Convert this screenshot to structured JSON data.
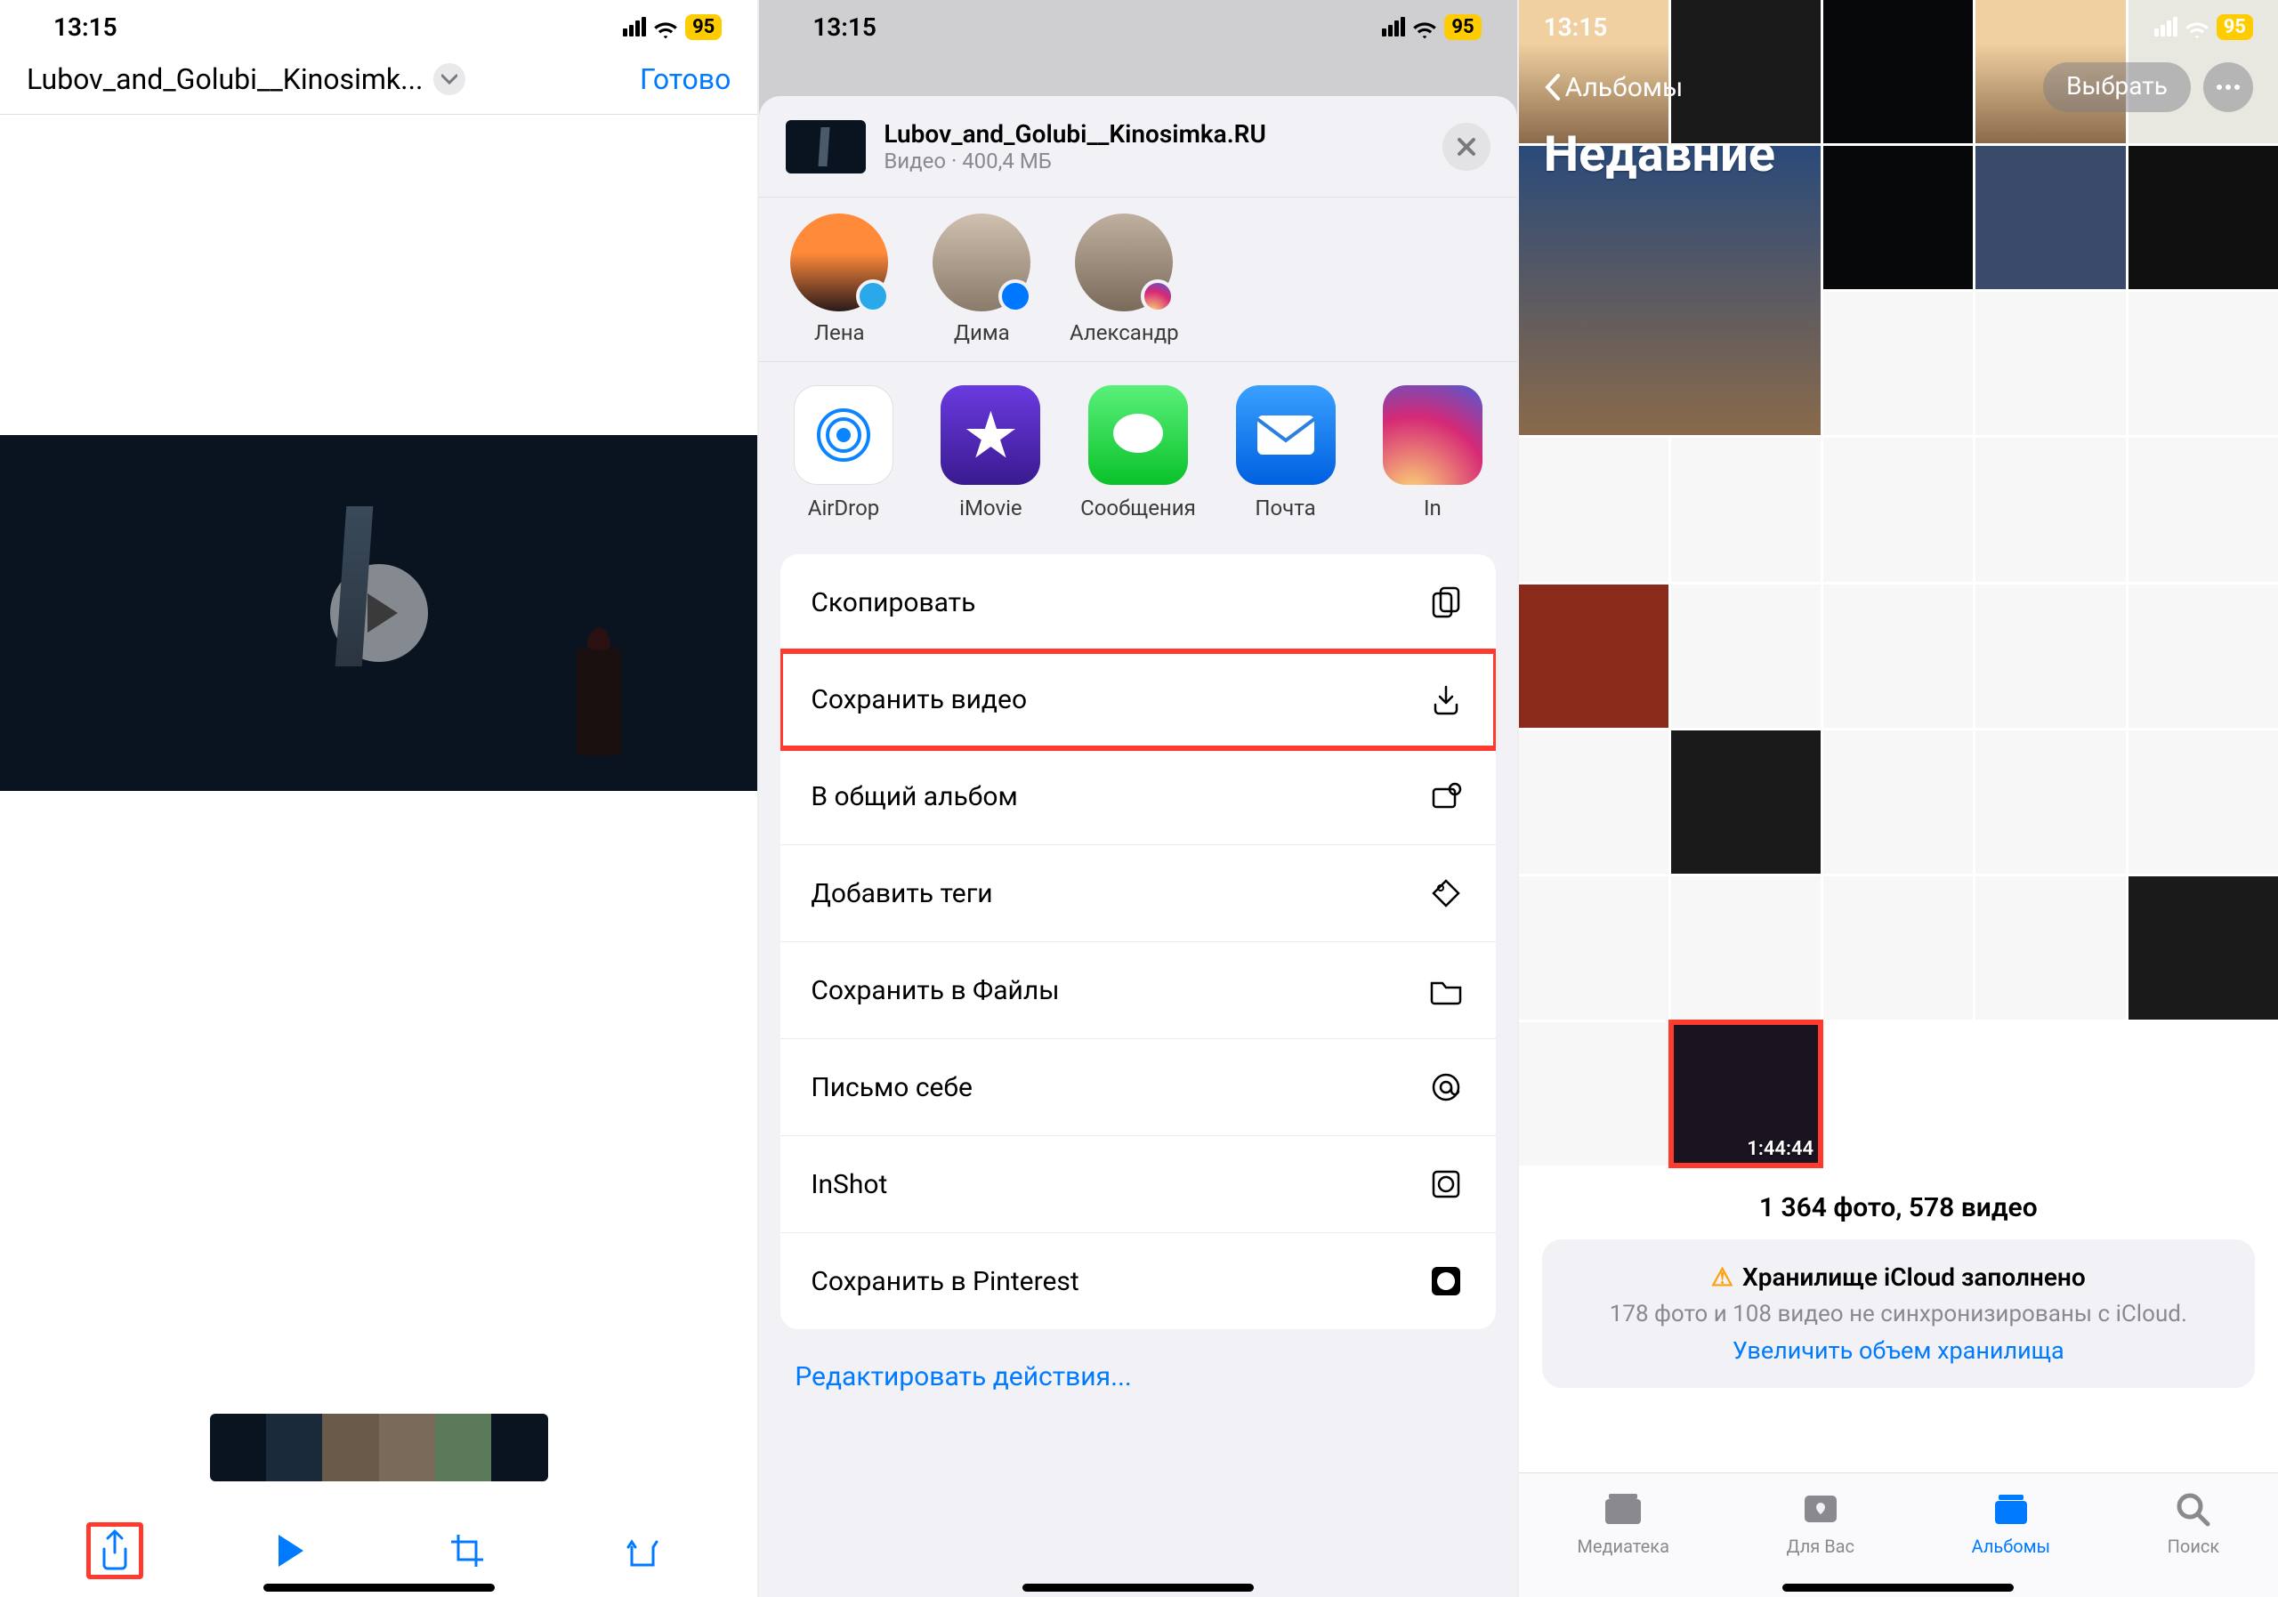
{
  "status": {
    "time": "13:15",
    "battery": "95"
  },
  "screen1": {
    "file_title": "Lubov_and_Golubi__Kinosimk...",
    "done": "Готово"
  },
  "screen2": {
    "file_name": "Lubov_and_Golubi__Kinosimka.RU",
    "file_meta": "Видео · 400,4 МБ",
    "contacts": {
      "c1": "Лена",
      "c2": "Дима",
      "c3": "Александр"
    },
    "apps": {
      "airdrop": "AirDrop",
      "imovie": "iMovie",
      "messages": "Сообщения",
      "mail": "Почта",
      "instagram": "In"
    },
    "actions": {
      "copy": "Скопировать",
      "save_video": "Сохранить видео",
      "shared_album": "В общий альбом",
      "add_tags": "Добавить теги",
      "save_files": "Сохранить в Файлы",
      "mail_self": "Письмо себе",
      "inshot": "InShot",
      "pinterest": "Сохранить в Pinterest"
    },
    "edit_actions": "Редактировать действия..."
  },
  "screen3": {
    "back": "Альбомы",
    "select": "Выбрать",
    "title": "Недавние",
    "video_duration": "1:44:44",
    "count": "1 364 фото, 578 видео",
    "cloud_title": "Хранилище iCloud заполнено",
    "cloud_sub": "178 фото и 108 видео не синхронизированы с iCloud.",
    "cloud_link": "Увеличить объем хранилища",
    "tabs": {
      "library": "Медиатека",
      "foryou": "Для Вас",
      "albums": "Альбомы",
      "search": "Поиск"
    }
  }
}
